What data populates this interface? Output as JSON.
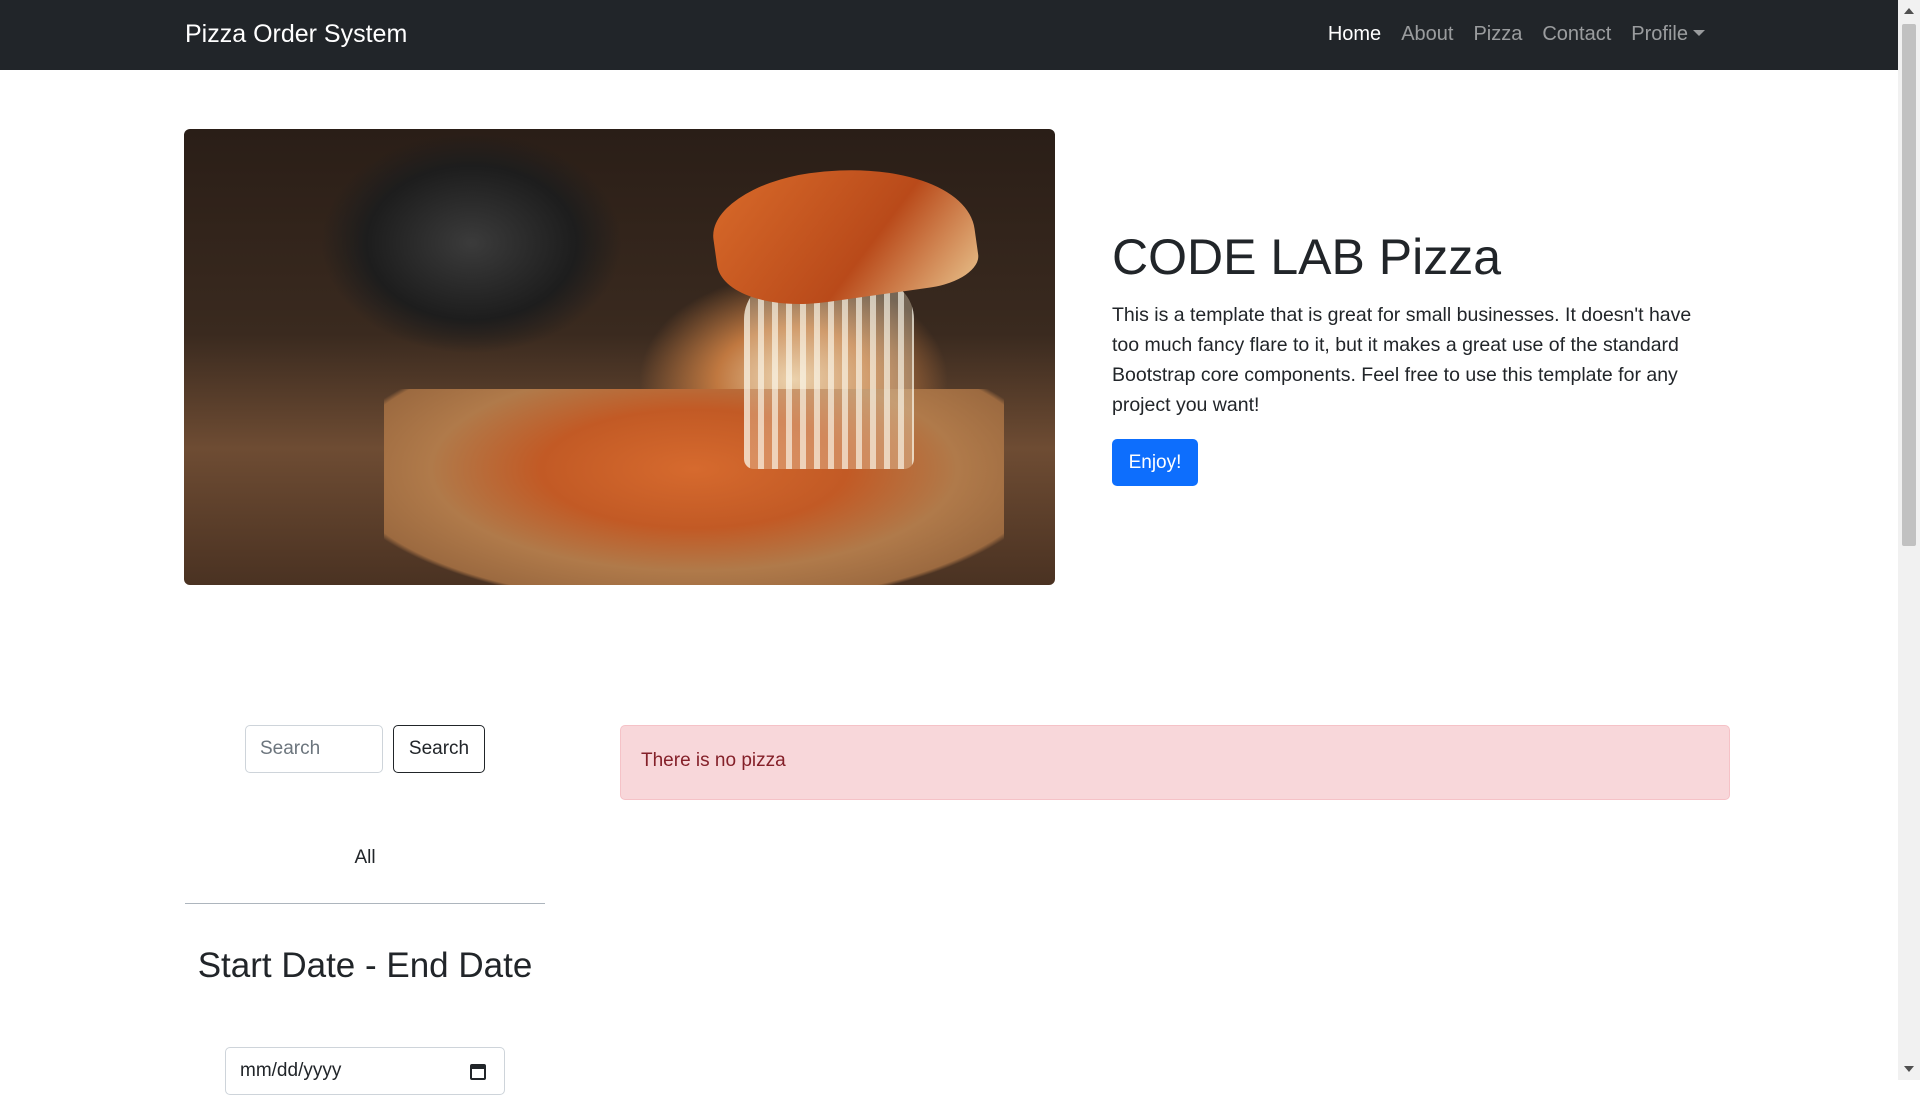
{
  "navbar": {
    "brand": "Pizza Order System",
    "items": [
      {
        "label": "Home",
        "active": true
      },
      {
        "label": "About",
        "active": false
      },
      {
        "label": "Pizza",
        "active": false
      },
      {
        "label": "Contact",
        "active": false
      },
      {
        "label": "Profile",
        "active": false,
        "dropdown": true
      }
    ]
  },
  "hero": {
    "title": "CODE LAB Pizza",
    "text": "This is a template that is great for small businesses. It doesn't have too much fancy flare to it, but it makes a great use of the standard Bootstrap core components. Feel free to use this template for any project you want!",
    "button_label": "Enjoy!"
  },
  "sidebar": {
    "search_placeholder": "Search",
    "search_button": "Search",
    "filter_all": "All",
    "date_heading": "Start Date - End Date",
    "date_placeholder": "mm/dd/yyyy"
  },
  "alert": {
    "message": "There is no pizza"
  },
  "colors": {
    "navbar_bg": "#212529",
    "primary": "#0d6efd",
    "alert_bg": "#f8d7da",
    "alert_text": "#842029"
  }
}
